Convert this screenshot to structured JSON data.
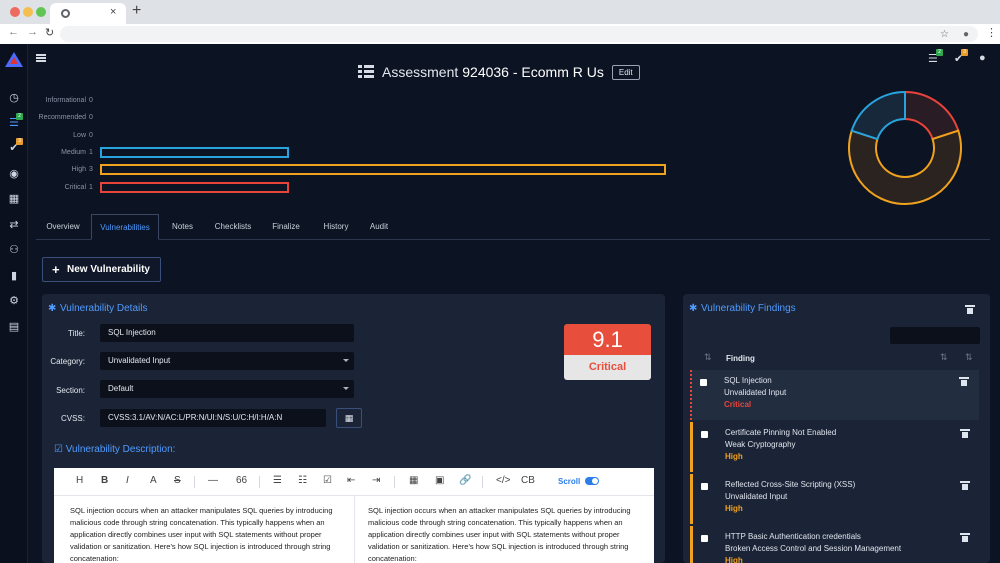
{
  "browser": {
    "traffic_lights": [
      "#ed6a5e",
      "#f5bf4f",
      "#61c554"
    ],
    "tab_close": "×",
    "new_tab": "+",
    "nav": {
      "back": "←",
      "forward": "→",
      "reload": "↻"
    },
    "star": "☆",
    "profile": "●",
    "menu": "⋮"
  },
  "header": {
    "title": "Assessment",
    "assessment_id": "924036 - Ecomm R Us",
    "edit_label": "Edit",
    "badge_tasks": "2",
    "badge_checks": "3"
  },
  "sidebar": {
    "badges": {
      "list": "2",
      "check": "3"
    },
    "icons": [
      "dashboard-icon",
      "list-icon",
      "check-icon",
      "eye-icon",
      "calendar-icon",
      "sync-icon",
      "team-icon",
      "reports-icon",
      "settings-icon",
      "document-icon"
    ]
  },
  "severity_chart": {
    "rows": [
      {
        "label": "Informational",
        "count": "0",
        "value": 0,
        "color": "#5b6b8c"
      },
      {
        "label": "Recommended",
        "count": "0",
        "value": 0,
        "color": "#5b6b8c"
      },
      {
        "label": "Low",
        "count": "0",
        "value": 0,
        "color": "#5b6b8c"
      },
      {
        "label": "Medium",
        "count": "1",
        "value": 1,
        "color": "#29a3dd"
      },
      {
        "label": "High",
        "count": "3",
        "value": 3,
        "color": "#f0a21e"
      },
      {
        "label": "Critical",
        "count": "1",
        "value": 1,
        "color": "#e8443a"
      }
    ],
    "max": 3
  },
  "donut": {
    "segments": [
      {
        "name": "Critical",
        "value": 1,
        "color": "#e8443a",
        "fill": "#2a1c25"
      },
      {
        "name": "High",
        "value": 3,
        "color": "#f0a21e",
        "fill": "#2a2320"
      },
      {
        "name": "Medium",
        "value": 1,
        "color": "#29a3dd",
        "fill": "#16283a"
      }
    ]
  },
  "tabs": [
    "Overview",
    "Vulnerabilities",
    "Notes",
    "Checklists",
    "Finalize",
    "History",
    "Audit"
  ],
  "active_tab": "Vulnerabilities",
  "new_vuln_label": "New Vulnerability",
  "details": {
    "panel_title": "Vulnerability Details",
    "title_label": "Title:",
    "title_value": "SQL Injection",
    "category_label": "Category:",
    "category_value": "Unvalidated Input",
    "section_label": "Section:",
    "section_value": "Default",
    "cvss_label": "CVSS:",
    "cvss_value": "CVSS:3.1/AV:N/AC:L/PR:N/UI:N/S:U/C:H/I:H/A:N",
    "score": "9.1",
    "severity": "Critical"
  },
  "description": {
    "title": "Vulnerability Description:",
    "toolbar": [
      "H",
      "B",
      "I",
      "A",
      "S",
      "—",
      "66",
      "☰",
      "☷",
      "☑",
      "⇤",
      "⇥",
      "▦",
      "▣",
      "🔗",
      "</>",
      "CB"
    ],
    "scroll_label": "Scroll",
    "text": "SQL injection occurs when an attacker manipulates SQL queries by introducing malicious code through string concatenation. This typically happens when an application directly combines user input with SQL statements without proper validation or sanitization. Here's how SQL injection is introduced through string concatenation:"
  },
  "findings": {
    "panel_title": "Vulnerability Findings",
    "column": "Finding",
    "items": [
      {
        "title": "SQL Injection",
        "category": "Unvalidated Input",
        "severity": "Critical",
        "color": "#e8443a"
      },
      {
        "title": "Certificate Pinning Not Enabled",
        "category": "Weak Cryptography",
        "severity": "High",
        "color": "#f0a21e"
      },
      {
        "title": "Reflected Cross-Site Scripting (XSS)",
        "category": "Unvalidated Input",
        "severity": "High",
        "color": "#f0a21e"
      },
      {
        "title": "HTTP Basic Authentication credentials",
        "category": "Broken Access Control and Session Management",
        "severity": "High",
        "color": "#f0a21e"
      }
    ]
  }
}
